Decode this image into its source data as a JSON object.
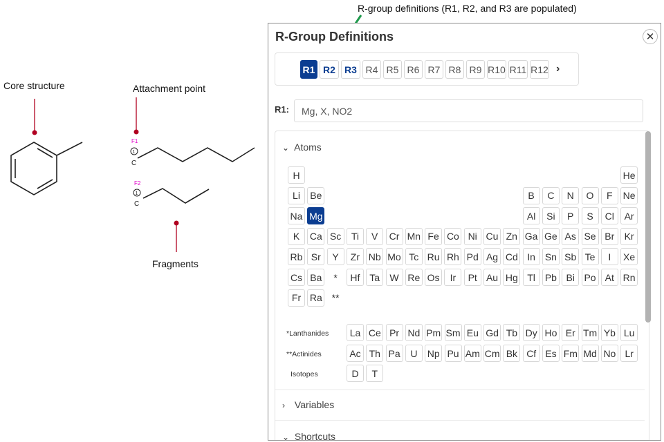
{
  "annotations": {
    "core_structure": "Core structure",
    "attachment_point": "Attachment point",
    "fragments": "Fragments",
    "rgroup_note": "R-group definitions (R1, R2, and R3 are populated)"
  },
  "fragment_labels": {
    "f1": "F1",
    "f1_num": "1",
    "f1_atom": "C",
    "f2": "F2",
    "f2_num": "1",
    "f2_atom": "C"
  },
  "colors": {
    "accent": "#0b3d91",
    "annotation_red": "#b00020",
    "arrow_green": "#1f9a4c",
    "fragment_magenta": "#e000c8"
  },
  "dialog": {
    "title": "R-Group Definitions",
    "close_icon": "close-icon",
    "next_icon": "chevron-right-icon",
    "r_tabs": [
      {
        "label": "R1",
        "state": "active"
      },
      {
        "label": "R2",
        "state": "populated"
      },
      {
        "label": "R3",
        "state": "populated"
      },
      {
        "label": "R4",
        "state": "empty"
      },
      {
        "label": "R5",
        "state": "empty"
      },
      {
        "label": "R6",
        "state": "empty"
      },
      {
        "label": "R7",
        "state": "empty"
      },
      {
        "label": "R8",
        "state": "empty"
      },
      {
        "label": "R9",
        "state": "empty"
      },
      {
        "label": "R10",
        "state": "empty"
      },
      {
        "label": "R11",
        "state": "empty"
      },
      {
        "label": "R12",
        "state": "empty"
      }
    ],
    "r1_label": "R1:",
    "r1_value": "Mg, X, NO2",
    "sections": {
      "atoms": "Atoms",
      "variables": "Variables",
      "shortcuts": "Shortcuts"
    },
    "selected_element": "Mg",
    "periodic_rows": [
      [
        [
          "H",
          0
        ],
        [
          "He",
          17
        ]
      ],
      [
        [
          "Li",
          0
        ],
        [
          "Be",
          1
        ],
        [
          "B",
          12
        ],
        [
          "C",
          13
        ],
        [
          "N",
          14
        ],
        [
          "O",
          15
        ],
        [
          "F",
          16
        ],
        [
          "Ne",
          17
        ]
      ],
      [
        [
          "Na",
          0
        ],
        [
          "Mg",
          1
        ],
        [
          "Al",
          12
        ],
        [
          "Si",
          13
        ],
        [
          "P",
          14
        ],
        [
          "S",
          15
        ],
        [
          "Cl",
          16
        ],
        [
          "Ar",
          17
        ]
      ],
      [
        [
          "K",
          0
        ],
        [
          "Ca",
          1
        ],
        [
          "Sc",
          2
        ],
        [
          "Ti",
          3
        ],
        [
          "V",
          4
        ],
        [
          "Cr",
          5
        ],
        [
          "Mn",
          6
        ],
        [
          "Fe",
          7
        ],
        [
          "Co",
          8
        ],
        [
          "Ni",
          9
        ],
        [
          "Cu",
          10
        ],
        [
          "Zn",
          11
        ],
        [
          "Ga",
          12
        ],
        [
          "Ge",
          13
        ],
        [
          "As",
          14
        ],
        [
          "Se",
          15
        ],
        [
          "Br",
          16
        ],
        [
          "Kr",
          17
        ]
      ],
      [
        [
          "Rb",
          0
        ],
        [
          "Sr",
          1
        ],
        [
          "Y",
          2
        ],
        [
          "Zr",
          3
        ],
        [
          "Nb",
          4
        ],
        [
          "Mo",
          5
        ],
        [
          "Tc",
          6
        ],
        [
          "Ru",
          7
        ],
        [
          "Rh",
          8
        ],
        [
          "Pd",
          9
        ],
        [
          "Ag",
          10
        ],
        [
          "Cd",
          11
        ],
        [
          "In",
          12
        ],
        [
          "Sn",
          13
        ],
        [
          "Sb",
          14
        ],
        [
          "Te",
          15
        ],
        [
          "I",
          16
        ],
        [
          "Xe",
          17
        ]
      ],
      [
        [
          "Cs",
          0
        ],
        [
          "Ba",
          1
        ],
        [
          "*",
          2
        ],
        [
          "Hf",
          3
        ],
        [
          "Ta",
          4
        ],
        [
          "W",
          5
        ],
        [
          "Re",
          6
        ],
        [
          "Os",
          7
        ],
        [
          "Ir",
          8
        ],
        [
          "Pt",
          9
        ],
        [
          "Au",
          10
        ],
        [
          "Hg",
          11
        ],
        [
          "Tl",
          12
        ],
        [
          "Pb",
          13
        ],
        [
          "Bi",
          14
        ],
        [
          "Po",
          15
        ],
        [
          "At",
          16
        ],
        [
          "Rn",
          17
        ]
      ],
      [
        [
          "Fr",
          0
        ],
        [
          "Ra",
          1
        ],
        [
          "**",
          2
        ]
      ]
    ],
    "series": [
      {
        "label": "*Lanthanides",
        "elements": [
          "La",
          "Ce",
          "Pr",
          "Nd",
          "Pm",
          "Sm",
          "Eu",
          "Gd",
          "Tb",
          "Dy",
          "Ho",
          "Er",
          "Tm",
          "Yb",
          "Lu"
        ]
      },
      {
        "label": "**Actinides",
        "elements": [
          "Ac",
          "Th",
          "Pa",
          "U",
          "Np",
          "Pu",
          "Am",
          "Cm",
          "Bk",
          "Cf",
          "Es",
          "Fm",
          "Md",
          "No",
          "Lr"
        ]
      },
      {
        "label": "Isotopes",
        "elements": [
          "D",
          "T"
        ]
      }
    ]
  }
}
